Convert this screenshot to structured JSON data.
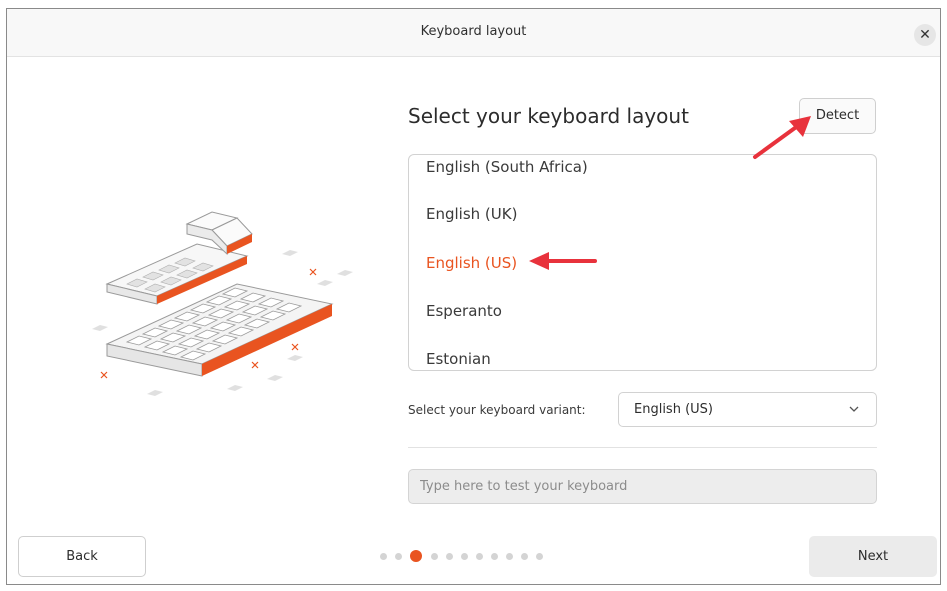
{
  "window": {
    "title": "Keyboard layout",
    "close_symbol": "✕"
  },
  "main": {
    "heading": "Select your keyboard layout",
    "detect_label": "Detect",
    "layouts": [
      {
        "label": "English (South Africa)",
        "selected": false
      },
      {
        "label": "English (UK)",
        "selected": false
      },
      {
        "label": "English (US)",
        "selected": true
      },
      {
        "label": "Esperanto",
        "selected": false
      },
      {
        "label": "Estonian",
        "selected": false
      }
    ],
    "variant_label": "Select your keyboard variant:",
    "variant_value": "English (US)",
    "test_placeholder": "Type here to test your keyboard"
  },
  "footer": {
    "back_label": "Back",
    "next_label": "Next",
    "step_total": 11,
    "step_current": 3
  },
  "colors": {
    "accent": "#e95420",
    "annotation": "#e8323c"
  },
  "icons": {
    "close": "close-icon",
    "chevron": "chevron-down-icon",
    "illustration": "keyboard-illustration"
  }
}
